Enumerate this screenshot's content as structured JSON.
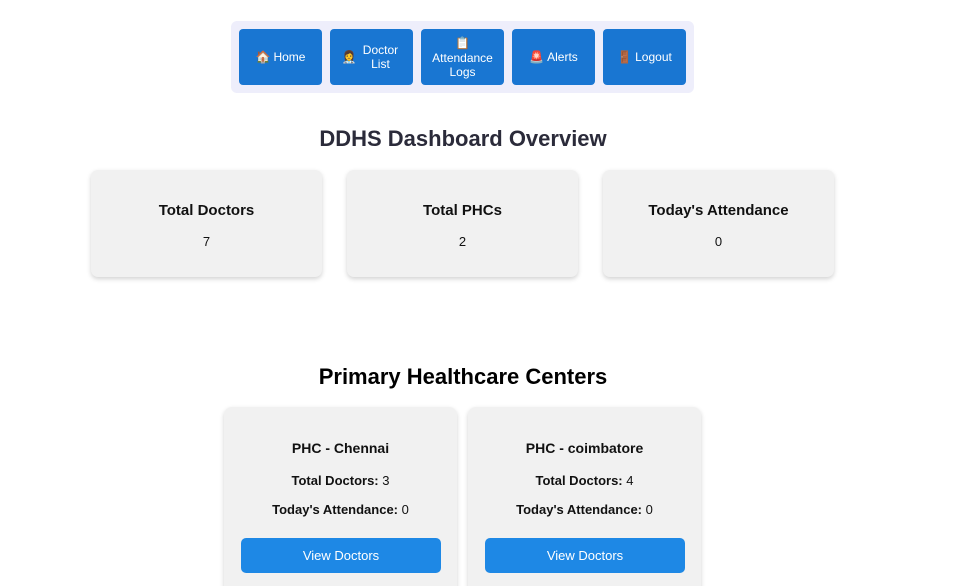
{
  "nav": {
    "items": [
      {
        "icon": "🏠",
        "label": "Home"
      },
      {
        "icon": "👩‍⚕️",
        "label": "Doctor List"
      },
      {
        "icon": "📋",
        "label": "Attendance Logs"
      },
      {
        "icon": "🚨",
        "label": "Alerts"
      },
      {
        "icon": "🚪",
        "label": "Logout"
      }
    ]
  },
  "overview": {
    "title": "DDHS Dashboard Overview",
    "stats": [
      {
        "label": "Total Doctors",
        "value": "7"
      },
      {
        "label": "Total PHCs",
        "value": "2"
      },
      {
        "label": "Today's Attendance",
        "value": "0"
      }
    ]
  },
  "phc_section": {
    "title": "Primary Healthcare Centers",
    "doctors_label": "Total Doctors:",
    "attendance_label": "Today's Attendance:",
    "button_label": "View Doctors",
    "centers": [
      {
        "name": "PHC - Chennai",
        "total_doctors": "3",
        "today_attendance": "0"
      },
      {
        "name": "PHC - coimbatore",
        "total_doctors": "4",
        "today_attendance": "0"
      }
    ]
  },
  "colors": {
    "nav_button": "#1976d2",
    "navbar_bg": "#eeeefb",
    "card_bg": "#f1f1f1",
    "view_button": "#1e88e5"
  }
}
